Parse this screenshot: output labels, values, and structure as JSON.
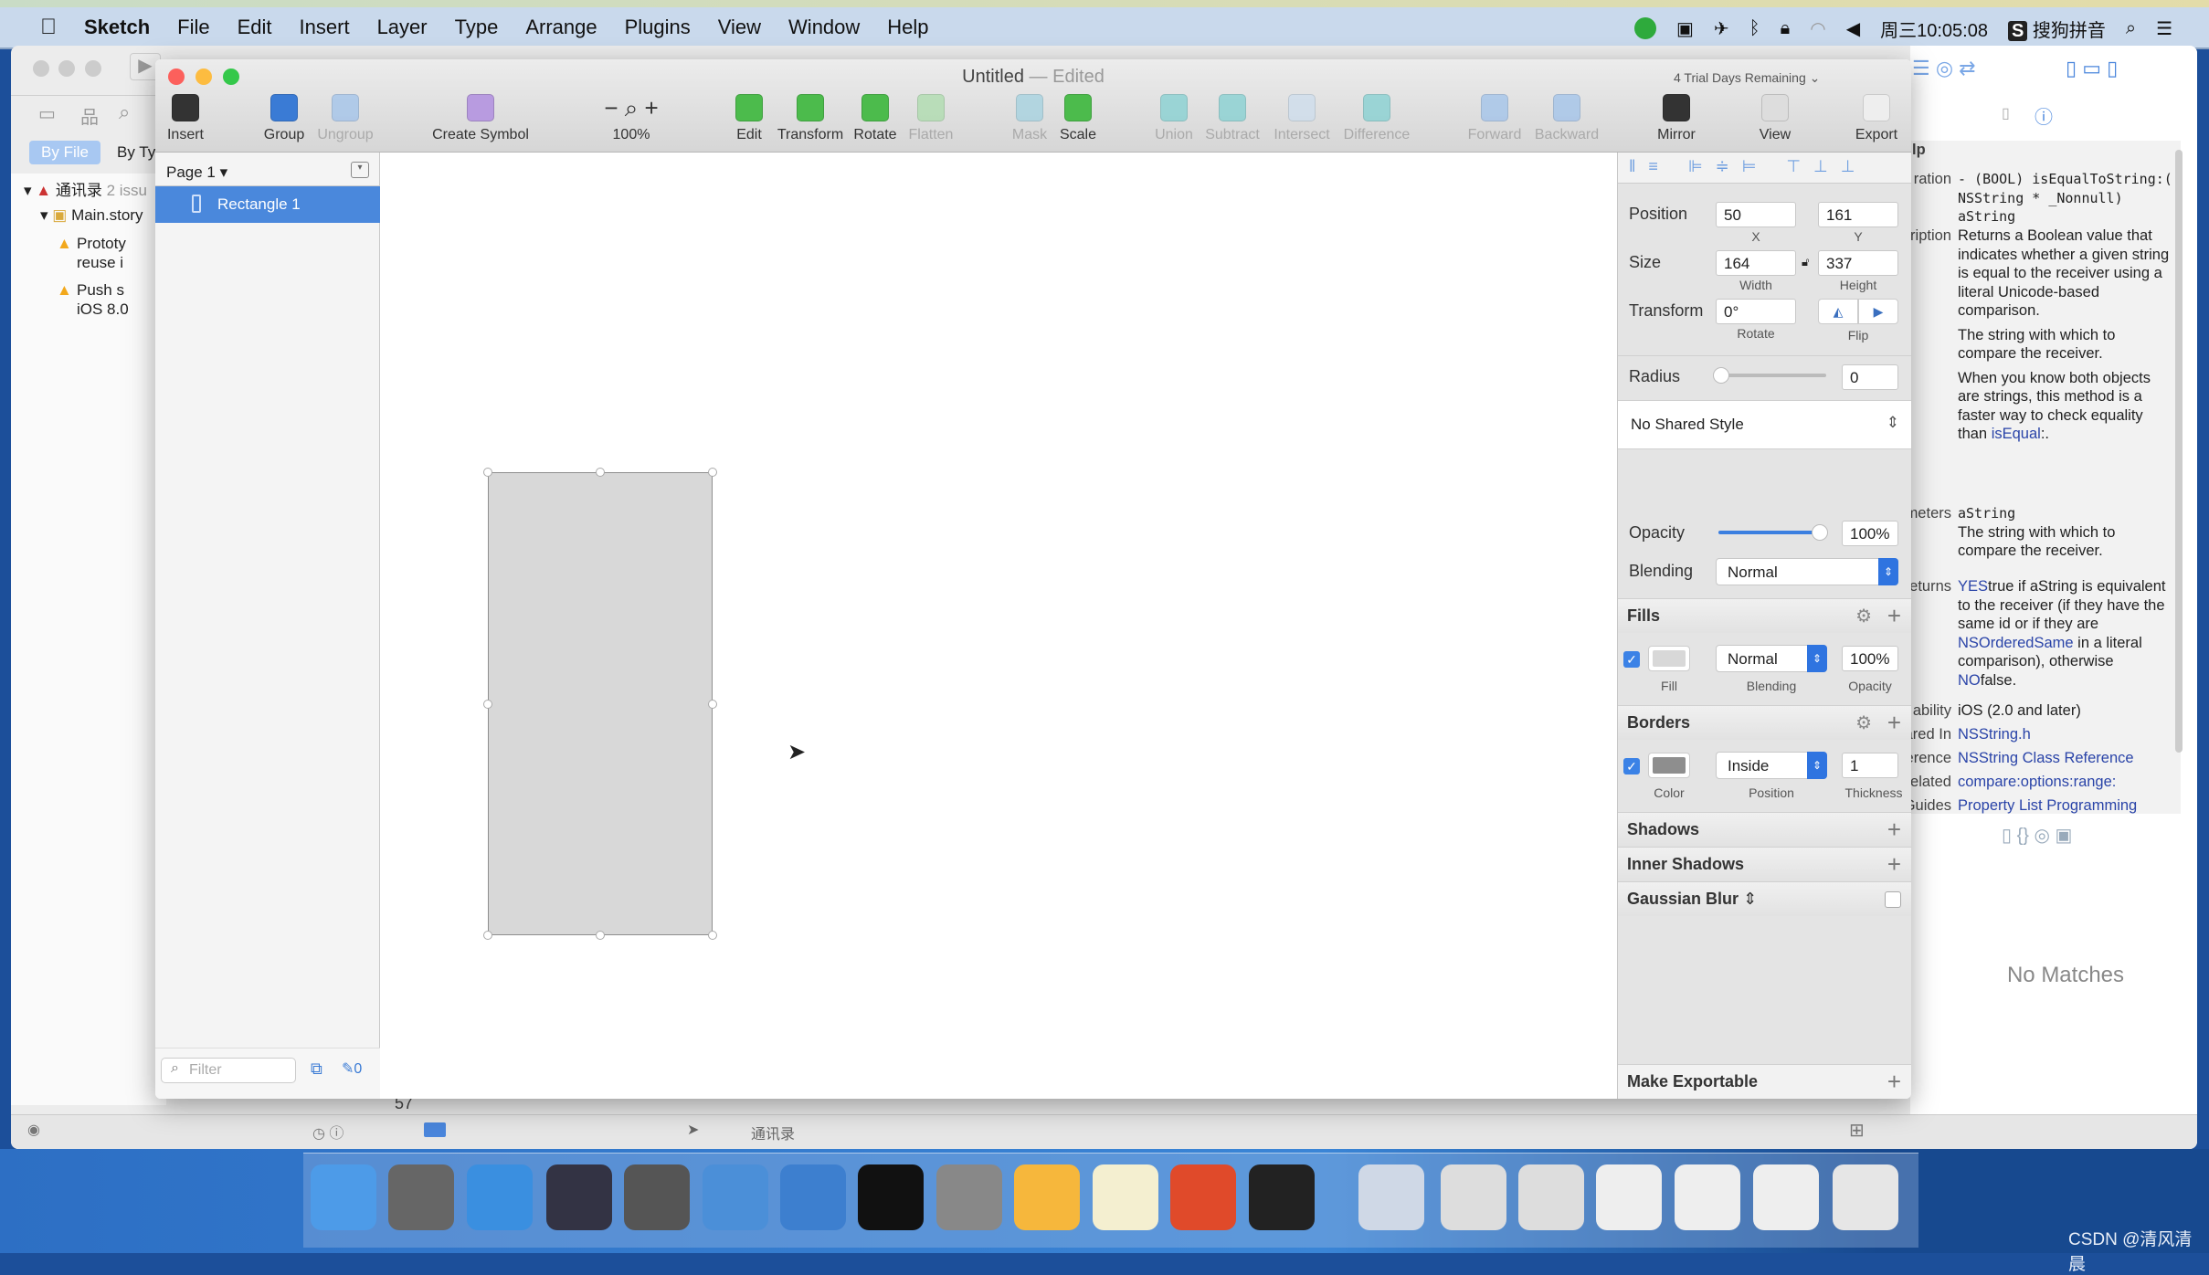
{
  "menubar": {
    "apple_icon": "apple-icon",
    "app": "Sketch",
    "items": [
      "File",
      "Edit",
      "Insert",
      "Layer",
      "Type",
      "Arrange",
      "Plugins",
      "View",
      "Window",
      "Help"
    ],
    "clock": "周三10:05:08",
    "input_method": "搜狗拼音"
  },
  "xcode": {
    "nav_tabs": [
      "By File",
      "By Ty"
    ],
    "tree": [
      {
        "label": "通讯录",
        "suffix": "2 issu"
      },
      {
        "label": "Main.story"
      },
      {
        "label": "Prototy",
        "line2": "reuse i"
      },
      {
        "label": "Push s",
        "line2": "iOS 8.0"
      }
    ],
    "bottom_label": "通讯录",
    "line_marker": "57",
    "no_matches": "No Matches",
    "help": {
      "title": "lp",
      "rows": [
        {
          "key": "ration",
          "value": "- (BOOL) isEqualToString:( NSString * _Nonnull) aString"
        },
        {
          "key": "ription",
          "value": "Returns a Boolean value that indicates whether a given string is equal to the receiver using a literal Unicode-based comparison.",
          "p2": "The string with which to compare the receiver.",
          "p3a": "When you know both objects are strings, this method is a faster way to check equality than ",
          "p3link": "isEqual",
          "p3b": ":."
        },
        {
          "key": "meters",
          "value": "aString",
          "p2": "The string with which to compare the receiver."
        },
        {
          "key": "eturns",
          "link1": "YES",
          "t1": "true if aString is equivalent to the receiver (if they have the same id or if they are ",
          "link2": "NSOrderedSame",
          "t2": " in a literal comparison), otherwise ",
          "link3": "NO",
          "t3": "false."
        },
        {
          "key": "ability",
          "value": "iOS (2.0 and later)"
        },
        {
          "key": "ared In",
          "value": "NSString.h"
        },
        {
          "key": "erence",
          "value": "NSString Class Reference"
        },
        {
          "key": "elated",
          "value": "compare:options:range:"
        },
        {
          "key": "Guides",
          "value": "Property List Programming"
        }
      ]
    }
  },
  "sketch": {
    "title": "Untitled",
    "edited": "— Edited",
    "trial": "4 Trial Days Remaining",
    "toolbar": [
      {
        "label": "Insert",
        "color": "#333333"
      },
      {
        "label": "Group",
        "color": "#3a7bd5"
      },
      {
        "label": "Ungroup",
        "color": "#9cc0ec",
        "disabled": true
      },
      {
        "label": "Create Symbol",
        "color": "#b89be0"
      },
      {
        "label": "100%",
        "color": "#333333"
      },
      {
        "label": "Edit",
        "color": "#4cbb4c"
      },
      {
        "label": "Transform",
        "color": "#4cbb4c"
      },
      {
        "label": "Rotate",
        "color": "#4cbb4c"
      },
      {
        "label": "Flatten",
        "color": "#a9dca9",
        "disabled": true
      },
      {
        "label": "Mask",
        "color": "#9fd0e0",
        "disabled": true
      },
      {
        "label": "Scale",
        "color": "#4cbb4c"
      },
      {
        "label": "Union",
        "color": "#7ccfd0",
        "disabled": true
      },
      {
        "label": "Subtract",
        "color": "#7ccfd0",
        "disabled": true
      },
      {
        "label": "Intersect",
        "color": "#cde",
        "disabled": true
      },
      {
        "label": "Difference",
        "color": "#7ccfd0",
        "disabled": true
      },
      {
        "label": "Forward",
        "color": "#9cc0ec",
        "disabled": true
      },
      {
        "label": "Backward",
        "color": "#9cc0ec",
        "disabled": true
      },
      {
        "label": "Mirror",
        "color": "#333333"
      },
      {
        "label": "View",
        "color": "#dddddd"
      },
      {
        "label": "Export",
        "color": "#eeeeee"
      }
    ],
    "zoom_minus": "−",
    "zoom_plus": "+",
    "layers": {
      "page": "Page 1",
      "items": [
        "Rectangle 1"
      ],
      "filter_placeholder": "Filter",
      "edit_count": "0"
    },
    "inspector": {
      "position": {
        "label": "Position",
        "x": "50",
        "y": "161",
        "x_label": "X",
        "y_label": "Y"
      },
      "size": {
        "label": "Size",
        "width": "164",
        "height": "337",
        "width_label": "Width",
        "height_label": "Height"
      },
      "transform": {
        "label": "Transform",
        "rotate": "0°",
        "rotate_label": "Rotate",
        "flip_label": "Flip"
      },
      "radius": {
        "label": "Radius",
        "value": "0"
      },
      "shared_style": "No Shared Style",
      "opacity": {
        "label": "Opacity",
        "value": "100%",
        "level": 1.0
      },
      "blending": {
        "label": "Blending",
        "value": "Normal"
      },
      "fills": {
        "title": "Fills",
        "enabled": true,
        "color": "#d8d8d8",
        "blending": "Normal",
        "opacity": "100%",
        "fill_label": "Fill",
        "blending_label": "Blending",
        "opacity_label": "Opacity"
      },
      "borders": {
        "title": "Borders",
        "enabled": true,
        "color": "#8e8e8e",
        "position": "Inside",
        "thickness": "1",
        "color_label": "Color",
        "position_label": "Position",
        "thickness_label": "Thickness"
      },
      "shadows": "Shadows",
      "inner_shadows": "Inner Shadows",
      "gaussian_blur": "Gaussian Blur",
      "make_exportable": "Make Exportable"
    }
  },
  "watermark": "CSDN @清风清晨"
}
